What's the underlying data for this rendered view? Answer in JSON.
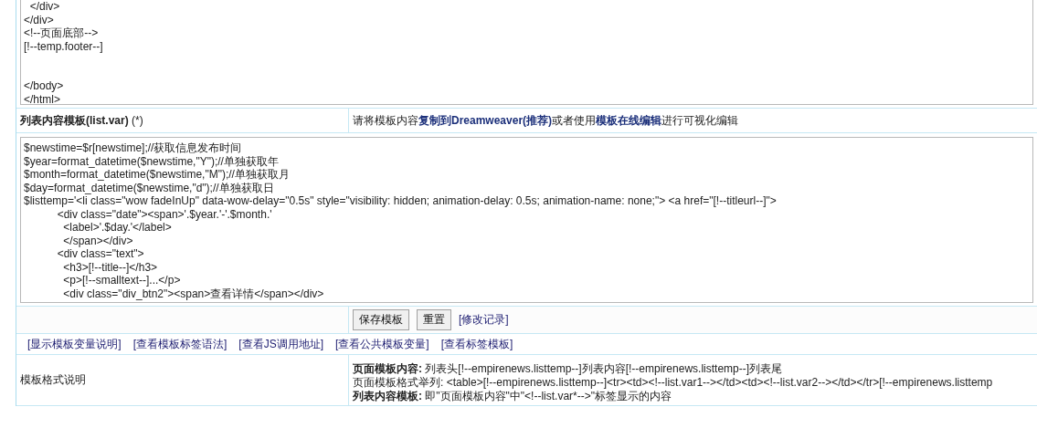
{
  "page_template_editor": {
    "value": "  </div>\n</div>\n<!--页面底部-->\n[!--temp.footer--]\n\n\n</body>\n</html>"
  },
  "list_template_header": {
    "label": "列表内容模板(list.var)",
    "required_mark": "(*)",
    "hint": "请将模板内容**复制到Dreamweaver(推荐)**或者使用**模板在线编辑**进行可视化编辑"
  },
  "list_template_editor": {
    "lines": [
      "$newstime=$r[newstime];//获取信息发布时间",
      "$year=format_datetime($newstime,\"Y\");//单独获取年",
      "$month=format_datetime($newstime,\"M\");//单独获取月",
      "$day=format_datetime($newstime,\"d\");//单独获取日",
      "$listtemp='<li class=\"wow fadeInUp\" data-wow-delay=\"0.5s\" style=\"visibility: hidden; animation-delay: 0.5s; animation-name: none;\"> <a href=\"[!--titleurl--]\">",
      "           <div class=\"date\"><span>'.$year.'-'.$month.'",
      "             <label>'.$day.'</label>",
      "             </span></div>",
      "           <div class=\"text\">",
      "             <h3>[!--title--]</h3>",
      "             <p>[!--smalltext--]...</p>",
      "             <div class=\"div_btn2\"><span>查看详情</span></div>"
    ]
  },
  "actions": {
    "buttons": [
      "保存模板",
      "重置"
    ],
    "link": "[修改记录]"
  },
  "help_links": [
    "[显示模板变量说明]",
    "[查看模板标签语法]",
    "[查看JS调用地址]",
    "[查看公共模板变量]",
    "[查看标签模板]"
  ],
  "format_description": {
    "label": "模板格式说明",
    "lines": [
      "**页面模板内容:** 列表头[!--empirenews.listtemp--]列表内容[!--empirenews.listtemp--]列表尾",
      "页面模板格式举列: <table>[!--empirenews.listtemp--]<tr><td><!--list.var1--></td><td><!--list.var2--></td></tr>[!--empirenews.listtemp",
      "**列表内容模板:** 即\"页面模板内容\"中\"<!--list.var*-->\"标签显示的内容"
    ]
  }
}
